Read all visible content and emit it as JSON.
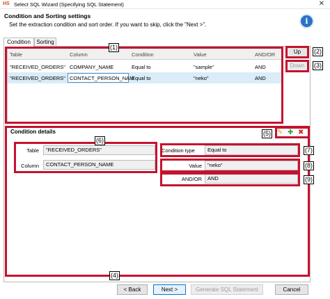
{
  "window": {
    "title": "Select SQL Wizard (Specifying SQL Statement)",
    "app_icon": "HS",
    "close_glyph": "✕"
  },
  "header": {
    "heading": "Condition and Sorting settings",
    "subheading": "Set the extraction condition and sort order. If you want to skip, click the \"Next >\".",
    "info_glyph": "i"
  },
  "tabs": [
    {
      "label": "Condition"
    },
    {
      "label": "Sorting"
    }
  ],
  "grid": {
    "columns": [
      "Table",
      "Column",
      "Condition",
      "Value",
      "AND/OR"
    ],
    "rows": [
      {
        "table": "\"RECEIVED_ORDERS\"",
        "column": "COMPANY_NAME",
        "condition": "Equal to",
        "value": "\"sample\"",
        "andor": "AND"
      },
      {
        "table": "\"RECEIVED_ORDERS\"",
        "column": "CONTACT_PERSON_NAM",
        "condition": "Equal to",
        "value": "\"neko\"",
        "andor": "AND"
      }
    ],
    "selected_row": 1
  },
  "side_buttons": {
    "up": "Up",
    "down": "Down"
  },
  "callouts": [
    "(1)",
    "(2)",
    "(3)",
    "(4)",
    "(5)",
    "(6)",
    "(7)",
    "(8)",
    "(9)"
  ],
  "details": {
    "title": "Condition details",
    "table_label": "Table",
    "table_value": "\"RECEIVED_ORDERS\"",
    "column_label": "Column",
    "column_value": "CONTACT_PERSON_NAME",
    "condition_type_label": "Condition type",
    "condition_type_value": "Equal to",
    "value_label": "Value",
    "value_value": "\"neko\"",
    "andor_label": "AND/OR",
    "andor_value": "AND"
  },
  "detail_icons": {
    "edit": "✎",
    "add": "✚",
    "delete": "✖"
  },
  "colors": {
    "callout_border": "#c4122f",
    "edit_icon": "#d9a520",
    "add_icon": "#2e9e3a",
    "delete_icon": "#d62424",
    "selected_row": "#d9ecf8",
    "info_icon": "#2a72c9"
  },
  "footer": {
    "back": "< Back",
    "next": "Next >",
    "generate": "Generate SQL Statement",
    "cancel": "Cancel"
  }
}
